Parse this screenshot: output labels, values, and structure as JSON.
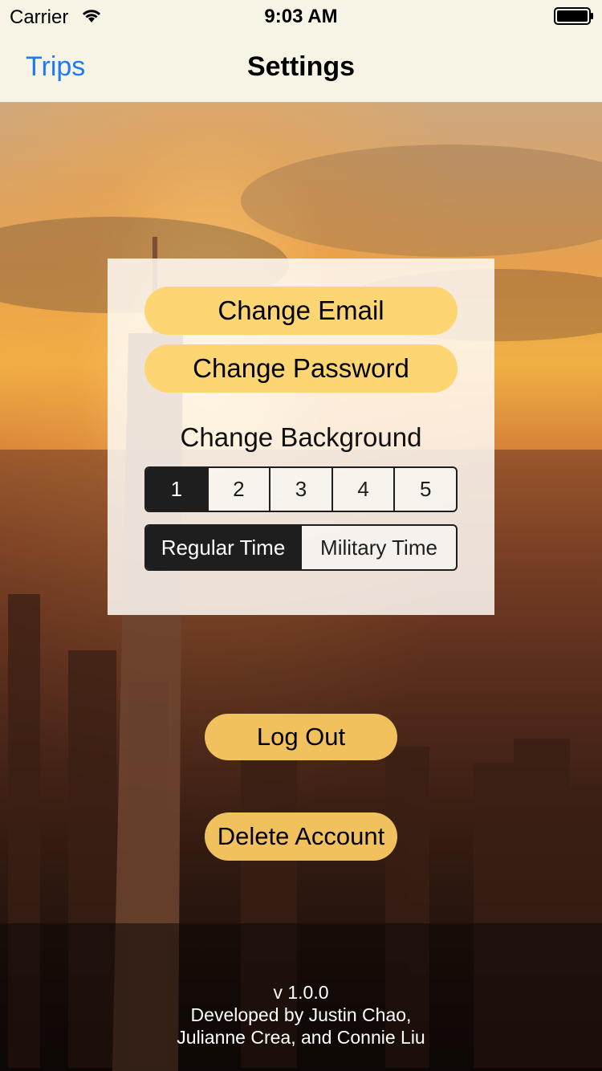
{
  "status_bar": {
    "carrier": "Carrier",
    "time": "9:03 AM",
    "wifi_icon": "wifi-icon",
    "battery_icon": "battery-full-icon"
  },
  "nav": {
    "back_label": "Trips",
    "title": "Settings"
  },
  "settings": {
    "change_email_label": "Change Email",
    "change_password_label": "Change Password",
    "change_background_label": "Change Background",
    "background_options": [
      "1",
      "2",
      "3",
      "4",
      "5"
    ],
    "background_selected": "1",
    "time_format_options": [
      "Regular Time",
      "Military Time"
    ],
    "time_format_selected": "Regular Time"
  },
  "actions": {
    "logout_label": "Log Out",
    "delete_account_label": "Delete Account"
  },
  "footer": {
    "version": "v 1.0.0",
    "credits_line1": "Developed by Justin Chao,",
    "credits_line2": "Julianne Crea, and Connie Liu"
  },
  "colors": {
    "nav_background": "#f7f3e5",
    "back_link": "#1d7af6",
    "button_primary": "#fed573",
    "button_secondary": "#f1c15e",
    "segment_selected": "#1e1e1e"
  }
}
